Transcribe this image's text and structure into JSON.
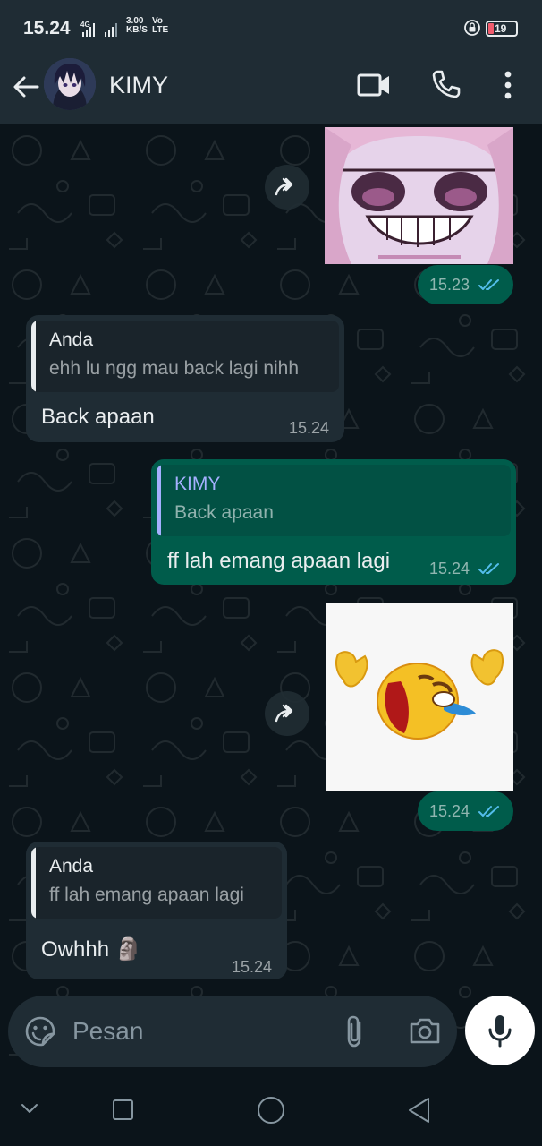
{
  "status_bar": {
    "time": "15.24",
    "network_speed": "3.00\nKB/S",
    "volte": "Vo\nLTE",
    "battery_level": "19"
  },
  "header": {
    "contact_name": "KIMY"
  },
  "messages": [
    {
      "type": "sticker",
      "direction": "out",
      "time": "15.23",
      "icon": "anime-face-sticker",
      "read": true
    },
    {
      "type": "reply",
      "direction": "in",
      "quote_author": "Anda",
      "quote_text": "ehh lu ngg mau back lagi nihh",
      "text": "Back apaan",
      "time": "15.24"
    },
    {
      "type": "reply",
      "direction": "out",
      "quote_author": "KIMY",
      "quote_text": "Back apaan",
      "text": "ff lah emang apaan lagi",
      "time": "15.24",
      "read": true
    },
    {
      "type": "sticker",
      "direction": "out",
      "time": "15.24",
      "icon": "laughing-emoji-sticker",
      "read": true
    },
    {
      "type": "reply",
      "direction": "in",
      "quote_author": "Anda",
      "quote_text": "ff lah emang apaan lagi",
      "text": "Owhhh 🗿",
      "time": "15.24"
    }
  ],
  "composer": {
    "placeholder": "Pesan"
  },
  "colors": {
    "background": "#0b141a",
    "bar": "#1f2c34",
    "incoming_bubble": "#1f2c34",
    "outgoing_bubble": "#005c4b",
    "read_ticks": "#53bdeb",
    "quote_author_in": "#e9edef",
    "quote_author_out": "#a5b0ff"
  }
}
